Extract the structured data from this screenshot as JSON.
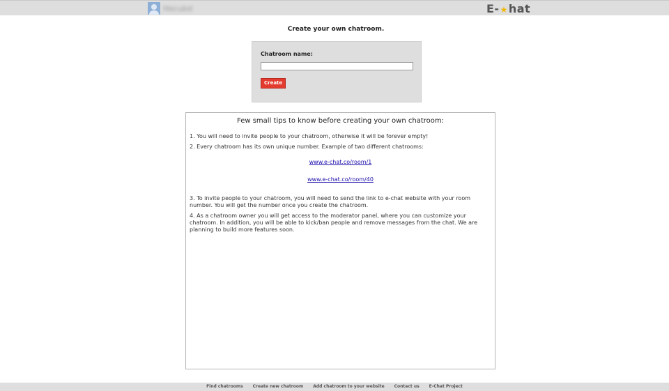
{
  "header": {
    "username": "Hecubd",
    "logo_prefix": "E-",
    "logo_suffix": "hat"
  },
  "page": {
    "title": "Create your own chatroom."
  },
  "form": {
    "label": "Chatroom name:",
    "input_value": "",
    "create_label": "Create"
  },
  "tips": {
    "heading": "Few small tips to know before creating your own chatroom:",
    "items": [
      "1. You will need to invite people to your chatroom, otherwise it will be forever empty!",
      "2. Every chatroom has its own unique number. Example of two different chatrooms:",
      "3. To invite people to your chatroom, you will need to send the link to e-chat website with your room number. You will get the number once you create the chatroom.",
      "4. As a chatroom owner you will get access to the moderator panel, where you can customize your chatroom. In addition, you will be able to kick/ban people and remove messages from the chat. We are planning to build more features soon."
    ],
    "links": [
      "www.e-chat.co/room/1",
      "www.e-chat.co/room/40"
    ]
  },
  "footer": {
    "links": [
      "Find chatrooms",
      "Create new chatroom",
      "Add chatroom to your website",
      "Contact us",
      "E-Chat Project"
    ]
  },
  "colors": {
    "accent": "#e33c2f",
    "link": "#1a0dab",
    "logo_star": "#f2b705"
  }
}
